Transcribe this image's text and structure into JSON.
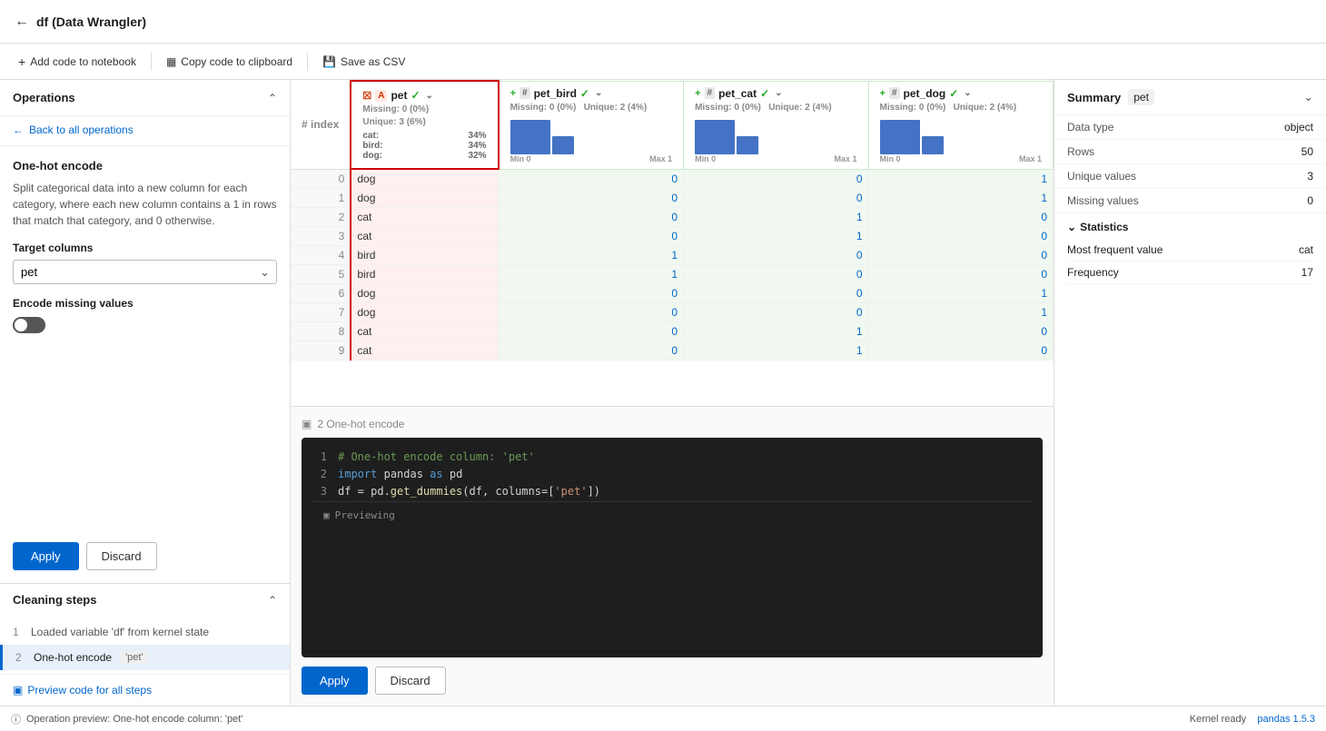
{
  "app": {
    "title": "df (Data Wrangler)"
  },
  "toolbar": {
    "add_code_label": "Add code to notebook",
    "copy_code_label": "Copy code to clipboard",
    "save_csv_label": "Save as CSV"
  },
  "left_panel": {
    "operations_title": "Operations",
    "back_link": "Back to all operations",
    "op_title": "One-hot encode",
    "op_desc": "Split categorical data into a new column for each category, where each new column contains a 1 in rows that match that category, and 0 otherwise.",
    "target_columns_label": "Target columns",
    "target_columns_value": "pet",
    "encode_missing_label": "Encode missing values",
    "apply_label": "Apply",
    "discard_label": "Discard"
  },
  "cleaning_steps": {
    "title": "Cleaning steps",
    "items": [
      {
        "num": "1",
        "text": "Loaded variable 'df' from kernel state",
        "active": false
      },
      {
        "num": "2",
        "text": "One-hot encode",
        "badge": "'pet'",
        "active": true
      }
    ],
    "preview_link": "Preview code for all steps"
  },
  "data_grid": {
    "columns": [
      {
        "id": "index",
        "label": "#  index",
        "type": "index"
      },
      {
        "id": "pet",
        "label": "pet",
        "type": "string",
        "selected": true,
        "missing": "0 (0%)",
        "unique": "3 (6%)",
        "dist": [
          [
            "cat:",
            "34%"
          ],
          [
            "bird:",
            "34%"
          ],
          [
            "dog:",
            "32%"
          ]
        ]
      },
      {
        "id": "pet_bird",
        "label": "# pet_bird",
        "type": "number",
        "new_col": true,
        "missing": "0 (0%)",
        "unique": "2 (4%)",
        "bar1": 65,
        "bar2": 35
      },
      {
        "id": "pet_cat",
        "label": "# pet_cat",
        "type": "number",
        "new_col": true,
        "missing": "0 (0%)",
        "unique": "2 (4%)",
        "bar1": 65,
        "bar2": 35
      },
      {
        "id": "pet_dog",
        "label": "# pet_dog",
        "type": "number",
        "new_col": true,
        "missing": "0 (0%)",
        "unique": "2 (4%)",
        "bar1": 65,
        "bar2": 35
      }
    ],
    "rows": [
      {
        "index": 0,
        "pet": "dog",
        "pet_bird": 0,
        "pet_cat": 0,
        "pet_dog": 1
      },
      {
        "index": 1,
        "pet": "dog",
        "pet_bird": 0,
        "pet_cat": 0,
        "pet_dog": 1
      },
      {
        "index": 2,
        "pet": "cat",
        "pet_bird": 0,
        "pet_cat": 1,
        "pet_dog": 0
      },
      {
        "index": 3,
        "pet": "cat",
        "pet_bird": 0,
        "pet_cat": 1,
        "pet_dog": 0
      },
      {
        "index": 4,
        "pet": "bird",
        "pet_bird": 1,
        "pet_cat": 0,
        "pet_dog": 0
      },
      {
        "index": 5,
        "pet": "bird",
        "pet_bird": 1,
        "pet_cat": 0,
        "pet_dog": 0
      },
      {
        "index": 6,
        "pet": "dog",
        "pet_bird": 0,
        "pet_cat": 0,
        "pet_dog": 1
      },
      {
        "index": 7,
        "pet": "dog",
        "pet_bird": 0,
        "pet_cat": 0,
        "pet_dog": 1
      },
      {
        "index": 8,
        "pet": "cat",
        "pet_bird": 0,
        "pet_cat": 1,
        "pet_dog": 0
      },
      {
        "index": 9,
        "pet": "cat",
        "pet_bird": 0,
        "pet_cat": 1,
        "pet_dog": 0
      }
    ]
  },
  "code_panel": {
    "op_label": "2  One-hot encode",
    "lines": [
      {
        "num": "1",
        "content": "# One-hot encode column: 'pet'"
      },
      {
        "num": "2",
        "content": "import pandas as pd"
      },
      {
        "num": "3",
        "content": "df = pd.get_dummies(df, columns=['pet'])"
      }
    ],
    "preview_label": "Previewing",
    "apply_label": "Apply",
    "discard_label": "Discard"
  },
  "right_panel": {
    "title": "Summary",
    "column_name": "pet",
    "data_type_label": "Data type",
    "data_type_value": "object",
    "rows_label": "Rows",
    "rows_value": "50",
    "unique_values_label": "Unique values",
    "unique_values_value": "3",
    "missing_values_label": "Missing values",
    "missing_values_value": "0",
    "statistics_title": "Statistics",
    "most_frequent_label": "Most frequent value",
    "most_frequent_value": "cat",
    "frequency_label": "Frequency",
    "frequency_value": "17"
  },
  "status_bar": {
    "message": "Operation preview: One-hot encode column: 'pet'",
    "kernel_label": "Kernel ready",
    "pandas_label": "pandas 1.5.3"
  }
}
